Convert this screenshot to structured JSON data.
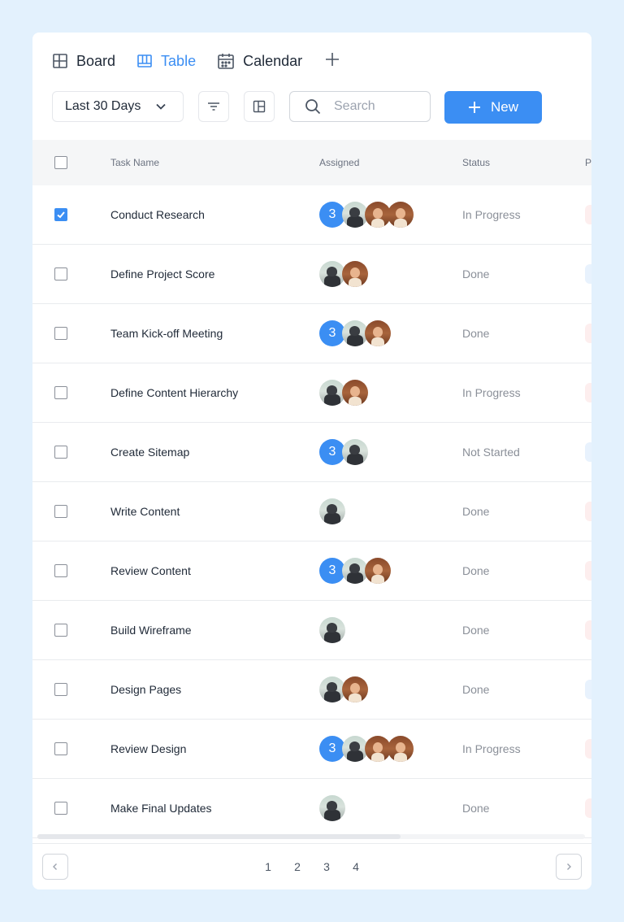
{
  "views": {
    "tabs": [
      {
        "label": "Board",
        "icon": "board-icon",
        "active": false
      },
      {
        "label": "Table",
        "icon": "table-icon",
        "active": true
      },
      {
        "label": "Calendar",
        "icon": "calendar-icon",
        "active": false
      }
    ],
    "add_icon": "plus-icon"
  },
  "toolbar": {
    "range_label": "Last 30 Days",
    "search_placeholder": "Search",
    "new_label": "New"
  },
  "table": {
    "columns": [
      "Task Name",
      "Assigned",
      "Status",
      "P"
    ],
    "rows": [
      {
        "name": "Conduct Research",
        "checked": true,
        "count": "3",
        "avatars": [
          "man",
          "woman",
          "woman"
        ],
        "status": "In Progress",
        "priority_color": "#fdeeee"
      },
      {
        "name": "Define Project Score",
        "checked": false,
        "count": "",
        "avatars": [
          "man",
          "woman"
        ],
        "status": "Done",
        "priority_color": "#e8f2fd"
      },
      {
        "name": "Team Kick-off Meeting",
        "checked": false,
        "count": "3",
        "avatars": [
          "man",
          "woman"
        ],
        "status": "Done",
        "priority_color": "#fdeeee"
      },
      {
        "name": "Define Content Hierarchy",
        "checked": false,
        "count": "",
        "avatars": [
          "man",
          "woman"
        ],
        "status": "In Progress",
        "priority_color": "#fdeeee"
      },
      {
        "name": "Create Sitemap",
        "checked": false,
        "count": "3",
        "avatars": [
          "man"
        ],
        "status": "Not Started",
        "priority_color": "#e8f2fd"
      },
      {
        "name": "Write Content",
        "checked": false,
        "count": "",
        "avatars": [
          "man"
        ],
        "status": "Done",
        "priority_color": "#fdeeee"
      },
      {
        "name": "Review Content",
        "checked": false,
        "count": "3",
        "avatars": [
          "man",
          "woman"
        ],
        "status": "Done",
        "priority_color": "#fdeeee"
      },
      {
        "name": "Build Wireframe",
        "checked": false,
        "count": "",
        "avatars": [
          "man"
        ],
        "status": "Done",
        "priority_color": "#fdeeee"
      },
      {
        "name": "Design Pages",
        "checked": false,
        "count": "",
        "avatars": [
          "man",
          "woman"
        ],
        "status": "Done",
        "priority_color": "#e8f2fd"
      },
      {
        "name": "Review Design",
        "checked": false,
        "count": "3",
        "avatars": [
          "man",
          "woman",
          "woman"
        ],
        "status": "In Progress",
        "priority_color": "#fdeeee"
      },
      {
        "name": "Make Final Updates",
        "checked": false,
        "count": "",
        "avatars": [
          "man"
        ],
        "status": "Done",
        "priority_color": "#fdeeee"
      }
    ]
  },
  "pagination": {
    "pages": [
      "1",
      "2",
      "3",
      "4"
    ],
    "prev_icon": "chevron-left-icon",
    "next_icon": "chevron-right-icon"
  },
  "colors": {
    "accent": "#3b8ef3",
    "page_background": "#e3f1fd",
    "header_background": "#f5f6f7"
  }
}
